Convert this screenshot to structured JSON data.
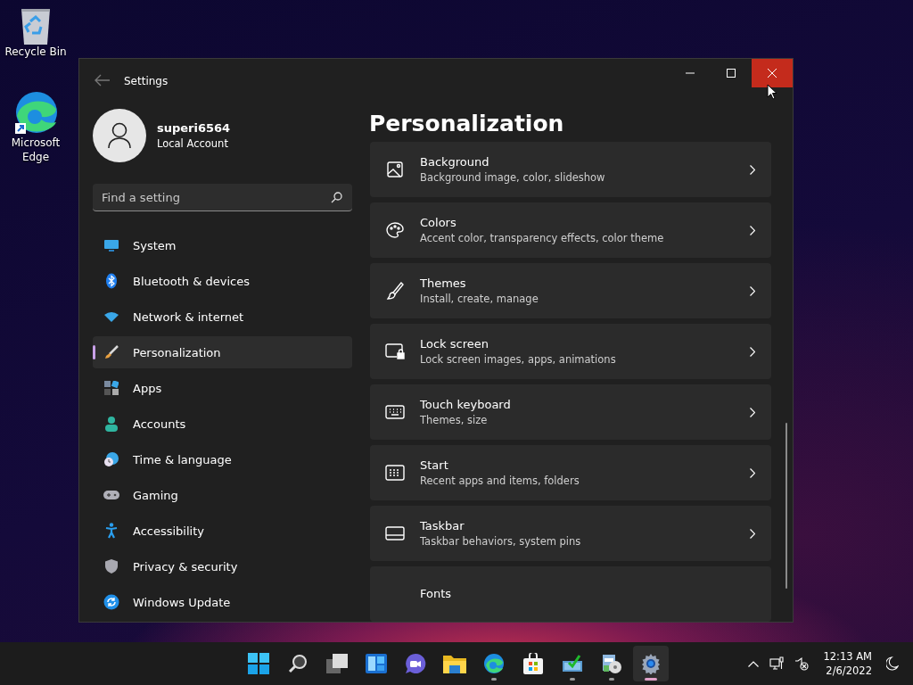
{
  "desktop_icons": [
    {
      "label": "Recycle Bin"
    },
    {
      "label": "Microsoft Edge"
    }
  ],
  "window": {
    "title": "Settings",
    "controls": [
      {
        "kind": "minimize",
        "hovered": false
      },
      {
        "kind": "maximize",
        "hovered": false
      },
      {
        "kind": "close",
        "hovered": true
      }
    ]
  },
  "account": {
    "name": "superi6564",
    "type": "Local Account"
  },
  "search": {
    "placeholder": "Find a setting"
  },
  "sidebar": {
    "items": [
      {
        "label": "System",
        "selected": false
      },
      {
        "label": "Bluetooth & devices",
        "selected": false
      },
      {
        "label": "Network & internet",
        "selected": false
      },
      {
        "label": "Personalization",
        "selected": true
      },
      {
        "label": "Apps",
        "selected": false
      },
      {
        "label": "Accounts",
        "selected": false
      },
      {
        "label": "Time & language",
        "selected": false
      },
      {
        "label": "Gaming",
        "selected": false
      },
      {
        "label": "Accessibility",
        "selected": false
      },
      {
        "label": "Privacy & security",
        "selected": false
      },
      {
        "label": "Windows Update",
        "selected": false
      }
    ]
  },
  "page": {
    "title": "Personalization",
    "cards": [
      {
        "title": "Background",
        "subtitle": "Background image, color, slideshow"
      },
      {
        "title": "Colors",
        "subtitle": "Accent color, transparency effects, color theme"
      },
      {
        "title": "Themes",
        "subtitle": "Install, create, manage"
      },
      {
        "title": "Lock screen",
        "subtitle": "Lock screen images, apps, animations"
      },
      {
        "title": "Touch keyboard",
        "subtitle": "Themes, size"
      },
      {
        "title": "Start",
        "subtitle": "Recent apps and items, folders"
      },
      {
        "title": "Taskbar",
        "subtitle": "Taskbar behaviors, system pins"
      },
      {
        "title": "Fonts"
      }
    ]
  },
  "taskbar": {
    "apps": [
      {
        "running": false,
        "selected": false
      },
      {
        "running": false,
        "selected": false
      },
      {
        "running": false,
        "selected": false
      },
      {
        "running": false,
        "selected": false
      },
      {
        "running": false,
        "selected": false
      },
      {
        "running": false,
        "selected": false
      },
      {
        "running": true,
        "selected": false
      },
      {
        "running": false,
        "selected": false
      },
      {
        "running": true,
        "selected": false
      },
      {
        "running": true,
        "selected": false
      },
      {
        "running": true,
        "selected": true
      }
    ],
    "time": "12:13 AM",
    "date": "2/6/2022"
  }
}
